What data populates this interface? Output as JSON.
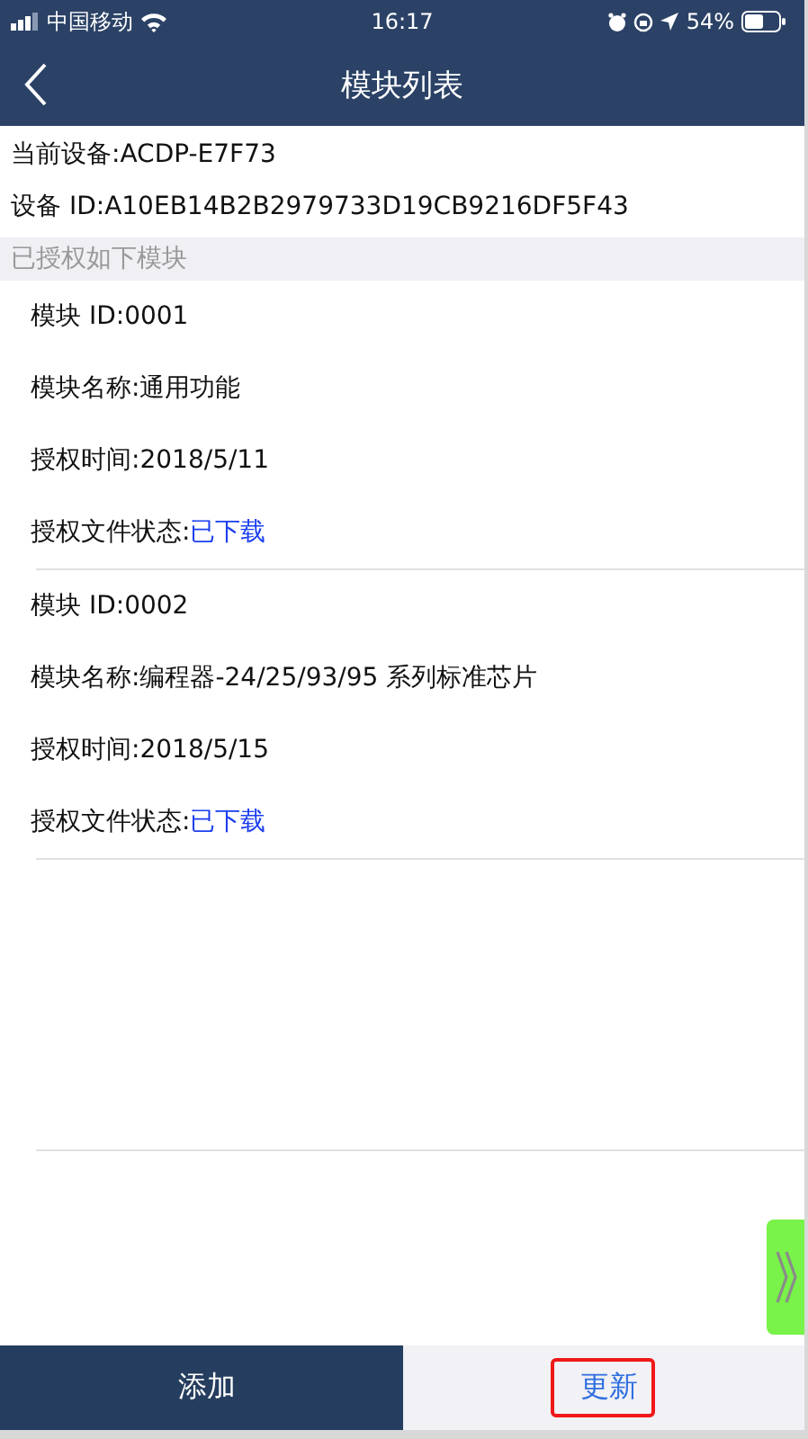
{
  "status_bar": {
    "carrier": "中国移动",
    "time": "16:17",
    "battery": "54%"
  },
  "nav": {
    "title": "模块列表"
  },
  "device": {
    "current": "当前设备:ACDP-E7F73",
    "id": "设备 ID:A10EB14B2B2979733D19CB9216DF5F43"
  },
  "section_header": "已授权如下模块",
  "modules": [
    {
      "id": "模块 ID:0001",
      "name": "模块名称:通用功能",
      "time": "授权时间:2018/5/11",
      "status_label": "授权文件状态:",
      "status": "已下载"
    },
    {
      "id": "模块 ID:0002",
      "name": "模块名称:编程器-24/25/93/95 系列标准芯片",
      "time": "授权时间:2018/5/15",
      "status_label": "授权文件状态:",
      "status": "已下载"
    }
  ],
  "bottom_buttons": [
    {
      "label": "添加",
      "kind": "primary",
      "highlighted": false
    },
    {
      "label": "更新",
      "kind": "secondary",
      "highlighted": true
    }
  ]
}
